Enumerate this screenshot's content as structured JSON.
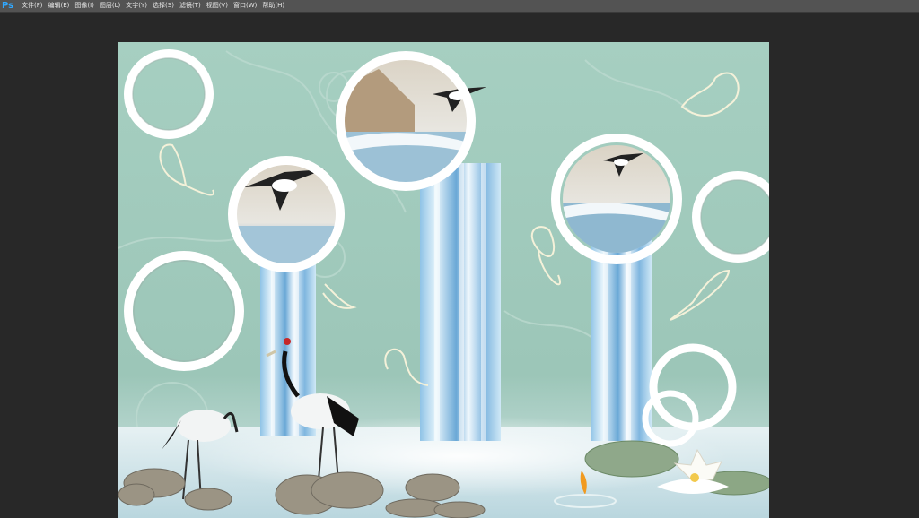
{
  "app": {
    "logo": "Ps",
    "menu": [
      "文件(F)",
      "编辑(E)",
      "图像(I)",
      "图层(L)",
      "文字(Y)",
      "选择(S)",
      "滤镜(T)",
      "视图(V)",
      "窗口(W)",
      "帮助(H)"
    ]
  },
  "document": {
    "description_icon": "image-canvas",
    "colors": {
      "wall": "#9fc9bb",
      "wall_dark": "#88b5a6",
      "ring": "#ffffff",
      "water": "#bfe0f2",
      "water_deep": "#5f9fcf",
      "workspace": "#282828",
      "menubar": "#535353"
    }
  }
}
